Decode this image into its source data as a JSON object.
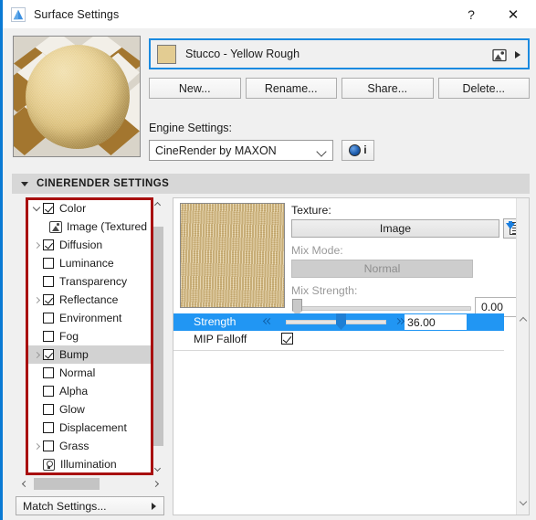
{
  "window": {
    "title": "Surface Settings",
    "app_icon": "archicad-triangle-icon",
    "help_label": "?",
    "close_label": "✕"
  },
  "preview": {
    "name": "material-sphere-preview"
  },
  "material": {
    "name": "Stucco - Yellow Rough",
    "swatch_color": "#e3cc92",
    "pick_icon": "image-picker-icon",
    "expand_arrow": "triangle-right-icon"
  },
  "buttons": {
    "new": "New...",
    "rename": "Rename...",
    "share": "Share...",
    "delete": "Delete..."
  },
  "engine": {
    "label": "Engine Settings:",
    "value": "CineRender by MAXON",
    "info_label": "i"
  },
  "section": {
    "title": "CINERENDER SETTINGS",
    "expanded": true
  },
  "tree": {
    "items": [
      {
        "label": "Color",
        "checkbox": "checked",
        "twisty": "down",
        "indent": 0,
        "selected": false,
        "icon": null
      },
      {
        "label": "Image (Textured Re",
        "checkbox": null,
        "twisty": null,
        "indent": 1,
        "selected": false,
        "icon": "image-icon"
      },
      {
        "label": "Diffusion",
        "checkbox": "checked",
        "twisty": "right",
        "indent": 0,
        "selected": false,
        "icon": null
      },
      {
        "label": "Luminance",
        "checkbox": "unchecked",
        "twisty": null,
        "indent": 0,
        "selected": false,
        "icon": null
      },
      {
        "label": "Transparency",
        "checkbox": "unchecked",
        "twisty": null,
        "indent": 0,
        "selected": false,
        "icon": null
      },
      {
        "label": "Reflectance",
        "checkbox": "checked",
        "twisty": "right",
        "indent": 0,
        "selected": false,
        "icon": null
      },
      {
        "label": "Environment",
        "checkbox": "unchecked",
        "twisty": null,
        "indent": 0,
        "selected": false,
        "icon": null
      },
      {
        "label": "Fog",
        "checkbox": "unchecked",
        "twisty": null,
        "indent": 0,
        "selected": false,
        "icon": null
      },
      {
        "label": "Bump",
        "checkbox": "checked",
        "twisty": "right",
        "indent": 0,
        "selected": true,
        "icon": null
      },
      {
        "label": "Normal",
        "checkbox": "unchecked",
        "twisty": null,
        "indent": 0,
        "selected": false,
        "icon": null
      },
      {
        "label": "Alpha",
        "checkbox": "unchecked",
        "twisty": null,
        "indent": 0,
        "selected": false,
        "icon": null
      },
      {
        "label": "Glow",
        "checkbox": "unchecked",
        "twisty": null,
        "indent": 0,
        "selected": false,
        "icon": null
      },
      {
        "label": "Displacement",
        "checkbox": "unchecked",
        "twisty": null,
        "indent": 0,
        "selected": false,
        "icon": null
      },
      {
        "label": "Grass",
        "checkbox": "unchecked",
        "twisty": "right",
        "indent": 0,
        "selected": false,
        "icon": null
      },
      {
        "label": "Illumination",
        "checkbox": null,
        "twisty": null,
        "indent": 0,
        "selected": false,
        "icon": "lamp-icon"
      }
    ],
    "highlight_color": "#a80f0f"
  },
  "match": {
    "label": "Match Settings...",
    "arrow": "triangle-right-icon"
  },
  "channel": {
    "texture_label": "Texture:",
    "texture_value": "Image",
    "texture_load_icon": "load-image-icon",
    "mix_mode_label": "Mix Mode:",
    "mix_mode_value": "Normal",
    "mix_mode_disabled": true,
    "mix_strength_label": "Mix Strength:",
    "mix_strength_value": "0.00",
    "strength_label": "Strength",
    "strength_value": "36.00",
    "strength_selected": true,
    "mip_falloff_label": "MIP Falloff",
    "mip_falloff_checked": true,
    "selection_color": "#2196f3"
  }
}
